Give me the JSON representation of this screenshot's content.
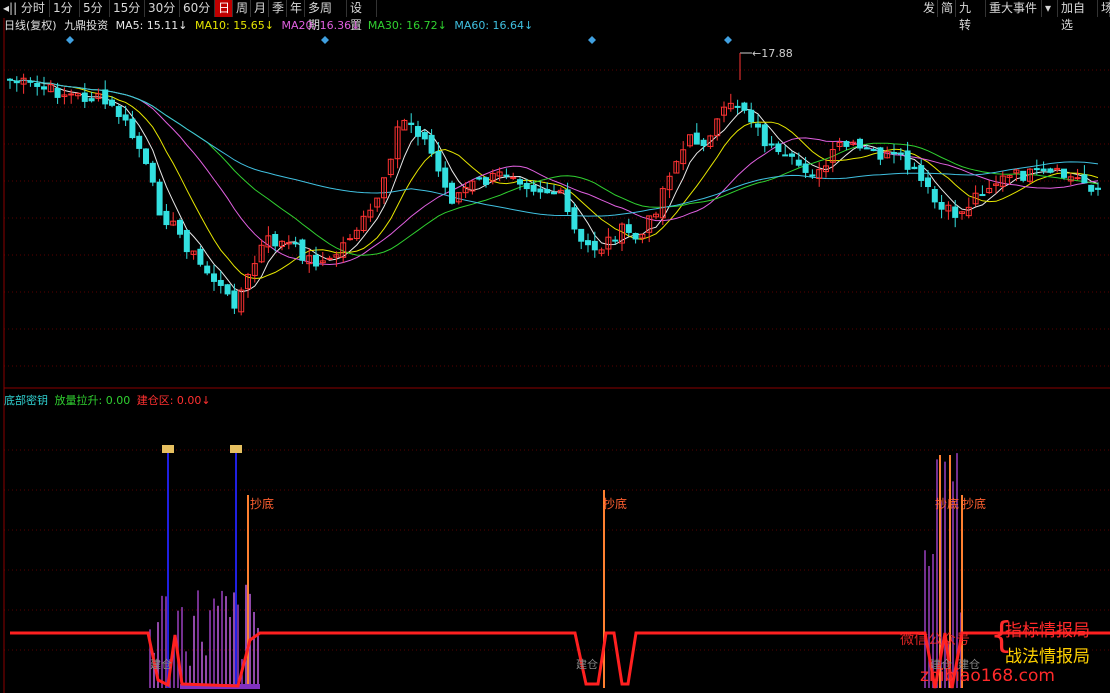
{
  "toolbar": {
    "left": [
      {
        "label": "◂|| 分时"
      },
      {
        "label": "1分"
      },
      {
        "label": "5分"
      },
      {
        "label": "15分"
      },
      {
        "label": "30分"
      },
      {
        "label": "60分"
      },
      {
        "label": "日",
        "active": true
      },
      {
        "label": "周"
      },
      {
        "label": "月"
      },
      {
        "label": "季"
      },
      {
        "label": "年"
      },
      {
        "label": "多周期"
      },
      {
        "label": "设置"
      }
    ],
    "right": [
      {
        "label": "发"
      },
      {
        "label": "简"
      },
      {
        "label": "九转"
      },
      {
        "label": "重大事件"
      },
      {
        "label": "▾"
      },
      {
        "label": "加自选"
      },
      {
        "label": "场"
      }
    ]
  },
  "main_chart": {
    "period_label": "日线(复权)",
    "stock_name": "九鼎投资",
    "ma": [
      {
        "label": "MA5: 15.11↓",
        "color": "#e8e8e8"
      },
      {
        "label": "MA10: 15.65↓",
        "color": "#e6e600"
      },
      {
        "label": "MA20: 16.36↓",
        "color": "#e060e0"
      },
      {
        "label": "MA30: 16.72↓",
        "color": "#30d030"
      },
      {
        "label": "MA60: 16.64↓",
        "color": "#40c0e0"
      }
    ],
    "high_marker": "←17.88",
    "colors": {
      "up": "#ff3333",
      "down": "#33e0e0",
      "grid": "#5a0000"
    }
  },
  "indicator": {
    "name": "底部密钥",
    "items": [
      {
        "label": "放量拉升: 0.00",
        "color": "#30d030"
      },
      {
        "label": "建仓区: 0.00↓",
        "color": "#ff3030"
      }
    ],
    "signal_labels": [
      "抄底",
      "抄底",
      "抄底",
      "抄底"
    ],
    "bottom_labels": [
      "建仓",
      "建仓",
      "建仓",
      "建仓"
    ]
  },
  "watermark": {
    "line1": "指标情报局",
    "line2": "战法情报局",
    "wechat": "微信公众号",
    "site": "zhibiao168.com"
  }
}
